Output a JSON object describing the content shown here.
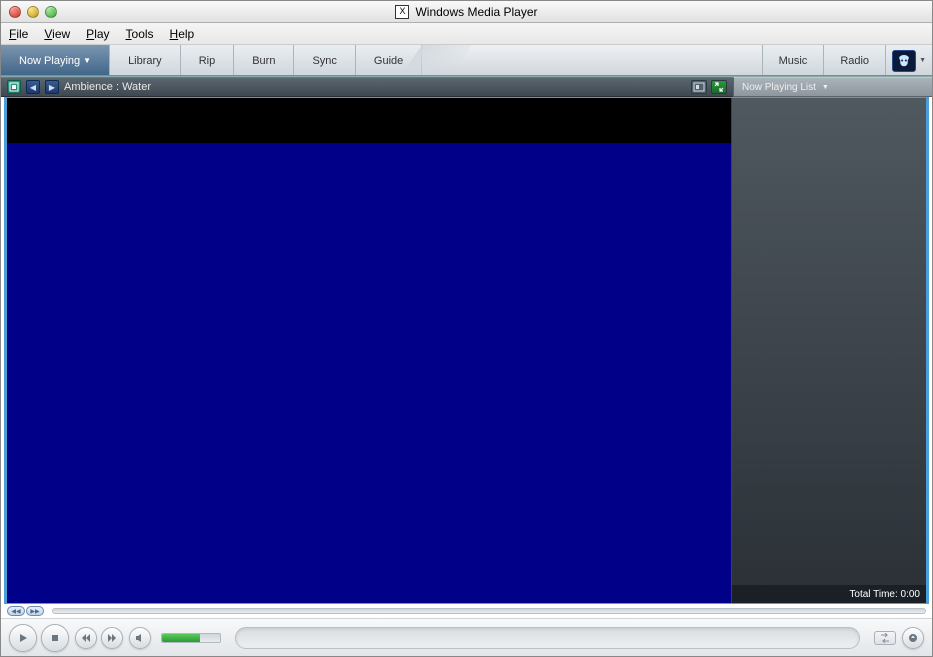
{
  "titlebar": {
    "title": "Windows Media Player"
  },
  "menubar": {
    "file": "File",
    "view": "View",
    "play": "Play",
    "tools": "Tools",
    "help": "Help"
  },
  "tabs": {
    "now_playing": "Now Playing",
    "library": "Library",
    "rip": "Rip",
    "burn": "Burn",
    "sync": "Sync",
    "guide": "Guide",
    "music": "Music",
    "radio": "Radio"
  },
  "infobar": {
    "track": "Ambience : Water"
  },
  "playlist": {
    "header": "Now Playing List",
    "total_time_label": "Total Time:",
    "total_time_value": "0:00"
  }
}
